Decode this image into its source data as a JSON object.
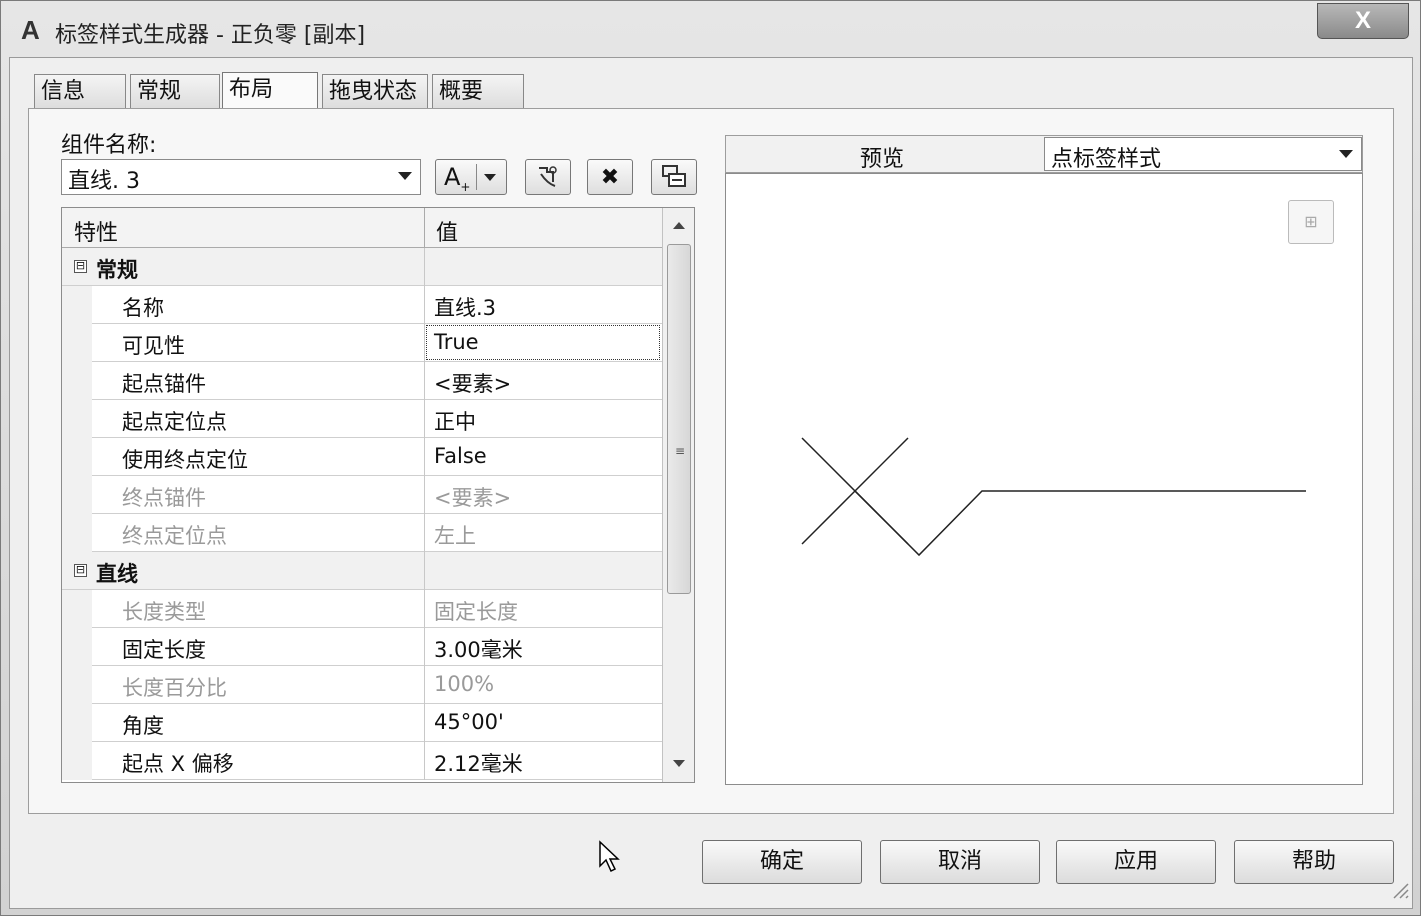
{
  "window": {
    "title": "标签样式生成器 - 正负零 [副本]",
    "close_label": "X",
    "app_icon": "A"
  },
  "tabs": [
    {
      "label": "信息",
      "active": false
    },
    {
      "label": "常规",
      "active": false
    },
    {
      "label": "布局",
      "active": true
    },
    {
      "label": "拖曳状态",
      "active": false
    },
    {
      "label": "概要",
      "active": false
    }
  ],
  "component": {
    "label": "组件名称:",
    "selected": "直线. 3",
    "toolbar": {
      "add_text_icon": "A",
      "add_text_sub": "+",
      "copy_icon": "copy-component-icon",
      "delete_icon": "✖",
      "order_icon": "draw-order-icon"
    }
  },
  "grid": {
    "col_property": "特性",
    "col_value": "值",
    "categories": {
      "general": {
        "label": "常规",
        "toggle": "⊟"
      },
      "line": {
        "label": "直线",
        "toggle": "⊟"
      }
    },
    "rows": [
      {
        "name": "名称",
        "value": "直线.3",
        "disabled": false
      },
      {
        "name": "可见性",
        "value": "True",
        "disabled": false,
        "selected": true
      },
      {
        "name": "起点锚件",
        "value": "<要素>",
        "disabled": false
      },
      {
        "name": "起点定位点",
        "value": "正中",
        "disabled": false
      },
      {
        "name": "使用终点定位",
        "value": "False",
        "disabled": false
      },
      {
        "name": "终点锚件",
        "value": "<要素>",
        "disabled": true
      },
      {
        "name": "终点定位点",
        "value": "左上",
        "disabled": true
      },
      {
        "name": "长度类型",
        "value": "固定长度",
        "disabled": true
      },
      {
        "name": "固定长度",
        "value": "3.00毫米",
        "disabled": false
      },
      {
        "name": "长度百分比",
        "value": "100%",
        "disabled": true
      },
      {
        "name": "角度",
        "value": "45°00'",
        "disabled": false
      },
      {
        "name": "起点 X 偏移",
        "value": "2.12毫米",
        "disabled": false
      }
    ]
  },
  "preview": {
    "label": "预览",
    "style_selected": "点标签样式",
    "zoom_btn": "⊞"
  },
  "footer": {
    "ok": "确定",
    "cancel": "取消",
    "apply": "应用",
    "help": "帮助"
  }
}
